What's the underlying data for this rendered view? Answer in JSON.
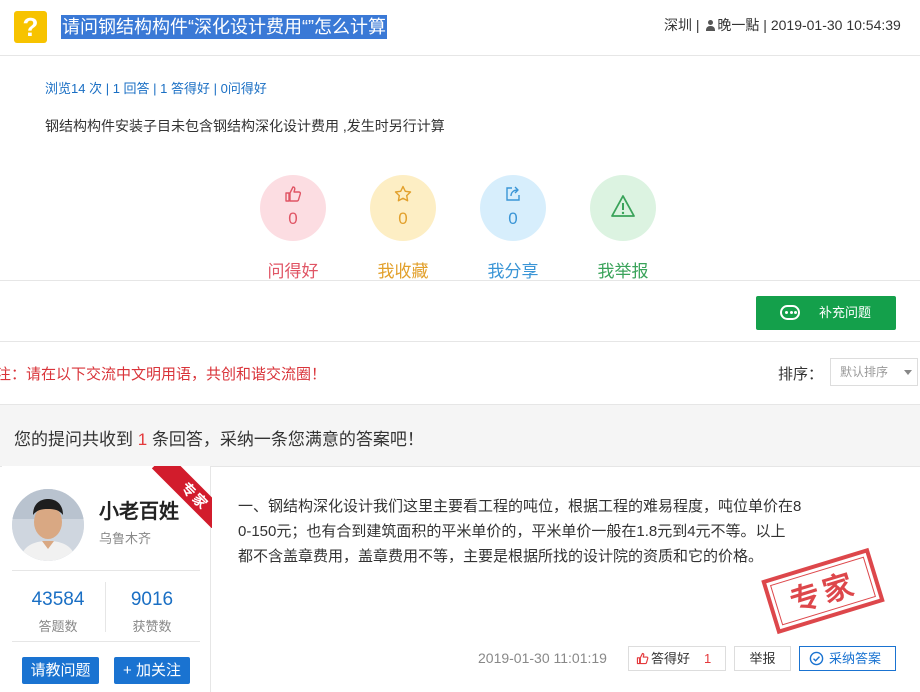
{
  "header": {
    "title": "请问钢结构构件“深化设计费用“”怎么计算",
    "location": "深圳",
    "author": "晚一點",
    "datetime": "2019-01-30 10:54:39"
  },
  "stats": {
    "views": "浏览14 次",
    "answers": "1 回答",
    "good": "1 答得好",
    "ask_good": "0问得好"
  },
  "question_body": "钢结构构件安装子目未包含钢结构深化设计费用 ,发生时另行计算",
  "reactions": [
    {
      "label": "问得好",
      "count": "0",
      "color": "#e05565",
      "bg": "#fcdde2",
      "icon": "thumbs-up-icon"
    },
    {
      "label": "我收藏",
      "count": "0",
      "color": "#e2a02c",
      "bg": "#fdeec4",
      "icon": "star-icon"
    },
    {
      "label": "我分享",
      "count": "0",
      "color": "#3a95d6",
      "bg": "#d7eefc",
      "icon": "share-icon"
    },
    {
      "label": "我举报",
      "count": "",
      "color": "#3aa35a",
      "bg": "#dcf3e1",
      "icon": "warning-icon"
    }
  ],
  "supplement_button": "补充问题",
  "notice": "注：请在以下交流中文明用语，共创和谐交流圈！",
  "sort": {
    "label": "排序：",
    "selected": "默认排序"
  },
  "summary": {
    "pre": "您的提问共收到",
    "count": "1",
    "post": "条回答，采纳一条您满意的答案吧！"
  },
  "answer": {
    "user": {
      "name": "小老百姓",
      "location": "乌鲁木齐",
      "badge": "专家",
      "answers_count": "43584",
      "answers_label": "答题数",
      "likes_count": "9016",
      "likes_label": "获赞数",
      "ask_button": "请教问题",
      "follow_button": "+ 加关注"
    },
    "lines": [
      "一、钢结构深化设计我们这里主要看工程的吨位，根据工程的难易程度，吨位单价在8",
      "0-150元；也有合到建筑面积的平米单价的，平米单价一般在1.8元到4元不等。以上",
      "都不含盖章费用，盖章费用不等，主要是根据所找的设计院的资质和它的价格。"
    ],
    "stamp": "专家",
    "date": "2019-01-30 11:01:19",
    "good_label": "答得好",
    "good_count": "1",
    "report_label": "举报",
    "adopt_label": "采纳答案"
  },
  "colors": {
    "accent_blue": "#1a73d1",
    "accent_green": "#14a04b",
    "accent_red": "#e4393c",
    "title_highlight": "#3a79d6"
  }
}
